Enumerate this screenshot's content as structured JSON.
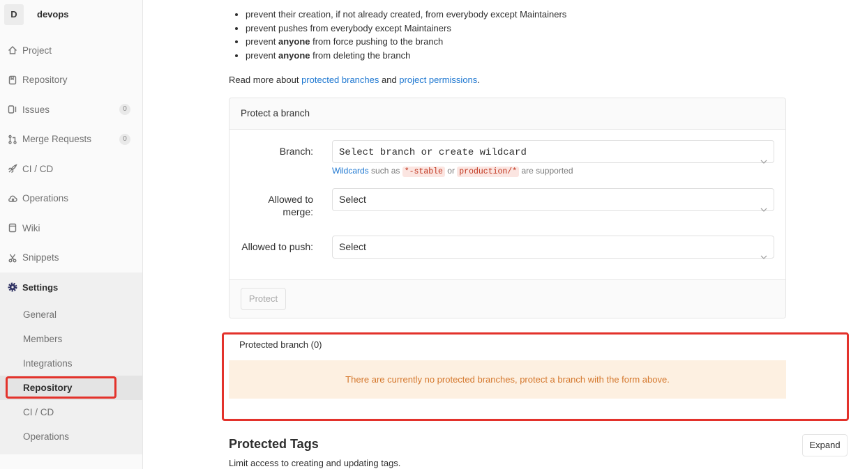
{
  "colors": {
    "link": "#1f78d1",
    "highlight_red": "#e3322b",
    "warning_bg": "#fdf0e1",
    "warning_text": "#d4772c",
    "code_text": "#c0341d",
    "code_bg": "#fbe5e1",
    "sidebar_bg": "#fafafa",
    "settings_section_bg": "#f0f0f0"
  },
  "sidebar": {
    "avatar_letter": "D",
    "project_name": "devops",
    "nav": [
      {
        "label": "Project",
        "icon": "home-icon"
      },
      {
        "label": "Repository",
        "icon": "document-icon"
      },
      {
        "label": "Issues",
        "icon": "issues-icon",
        "badge": "0"
      },
      {
        "label": "Merge Requests",
        "icon": "merge-request-icon",
        "badge": "0"
      },
      {
        "label": "CI / CD",
        "icon": "rocket-icon"
      },
      {
        "label": "Operations",
        "icon": "cloud-gear-icon"
      },
      {
        "label": "Wiki",
        "icon": "book-icon"
      },
      {
        "label": "Snippets",
        "icon": "scissors-icon"
      }
    ],
    "settings": {
      "label": "Settings",
      "icon": "gear-icon",
      "sub_items": [
        {
          "label": "General"
        },
        {
          "label": "Members"
        },
        {
          "label": "Integrations"
        },
        {
          "label": "Repository",
          "active": true
        },
        {
          "label": "CI / CD"
        },
        {
          "label": "Operations"
        }
      ]
    }
  },
  "intro": {
    "bullets": [
      {
        "pre": "prevent their creation, if not already created, from everybody except Maintainers"
      },
      {
        "pre": "prevent pushes from everybody except Maintainers"
      },
      {
        "pre": "prevent ",
        "bold": "anyone",
        "post": " from force pushing to the branch"
      },
      {
        "pre": "prevent ",
        "bold": "anyone",
        "post": " from deleting the branch"
      }
    ],
    "read_more": {
      "prefix": "Read more about ",
      "link1": "protected branches",
      "middle": " and ",
      "link2": "project permissions",
      "suffix": "."
    }
  },
  "protect_form": {
    "title": "Protect a branch",
    "branch": {
      "label": "Branch:",
      "value": "Select branch or create wildcard"
    },
    "help": {
      "link": "Wildcards",
      "t1": " such as ",
      "code1": "*-stable",
      "t2": " or ",
      "code2": "production/*",
      "t3": " are supported"
    },
    "merge": {
      "label": "Allowed to merge:",
      "value": "Select"
    },
    "push": {
      "label": "Allowed to push:",
      "value": "Select"
    },
    "submit_label": "Protect",
    "submit_disabled": "disabled"
  },
  "protected_branches": {
    "heading": "Protected branch (0)",
    "empty_message": "There are currently no protected branches, protect a branch with the form above."
  },
  "protected_tags": {
    "heading": "Protected Tags",
    "description": "Limit access to creating and updating tags.",
    "expand_label": "Expand"
  }
}
